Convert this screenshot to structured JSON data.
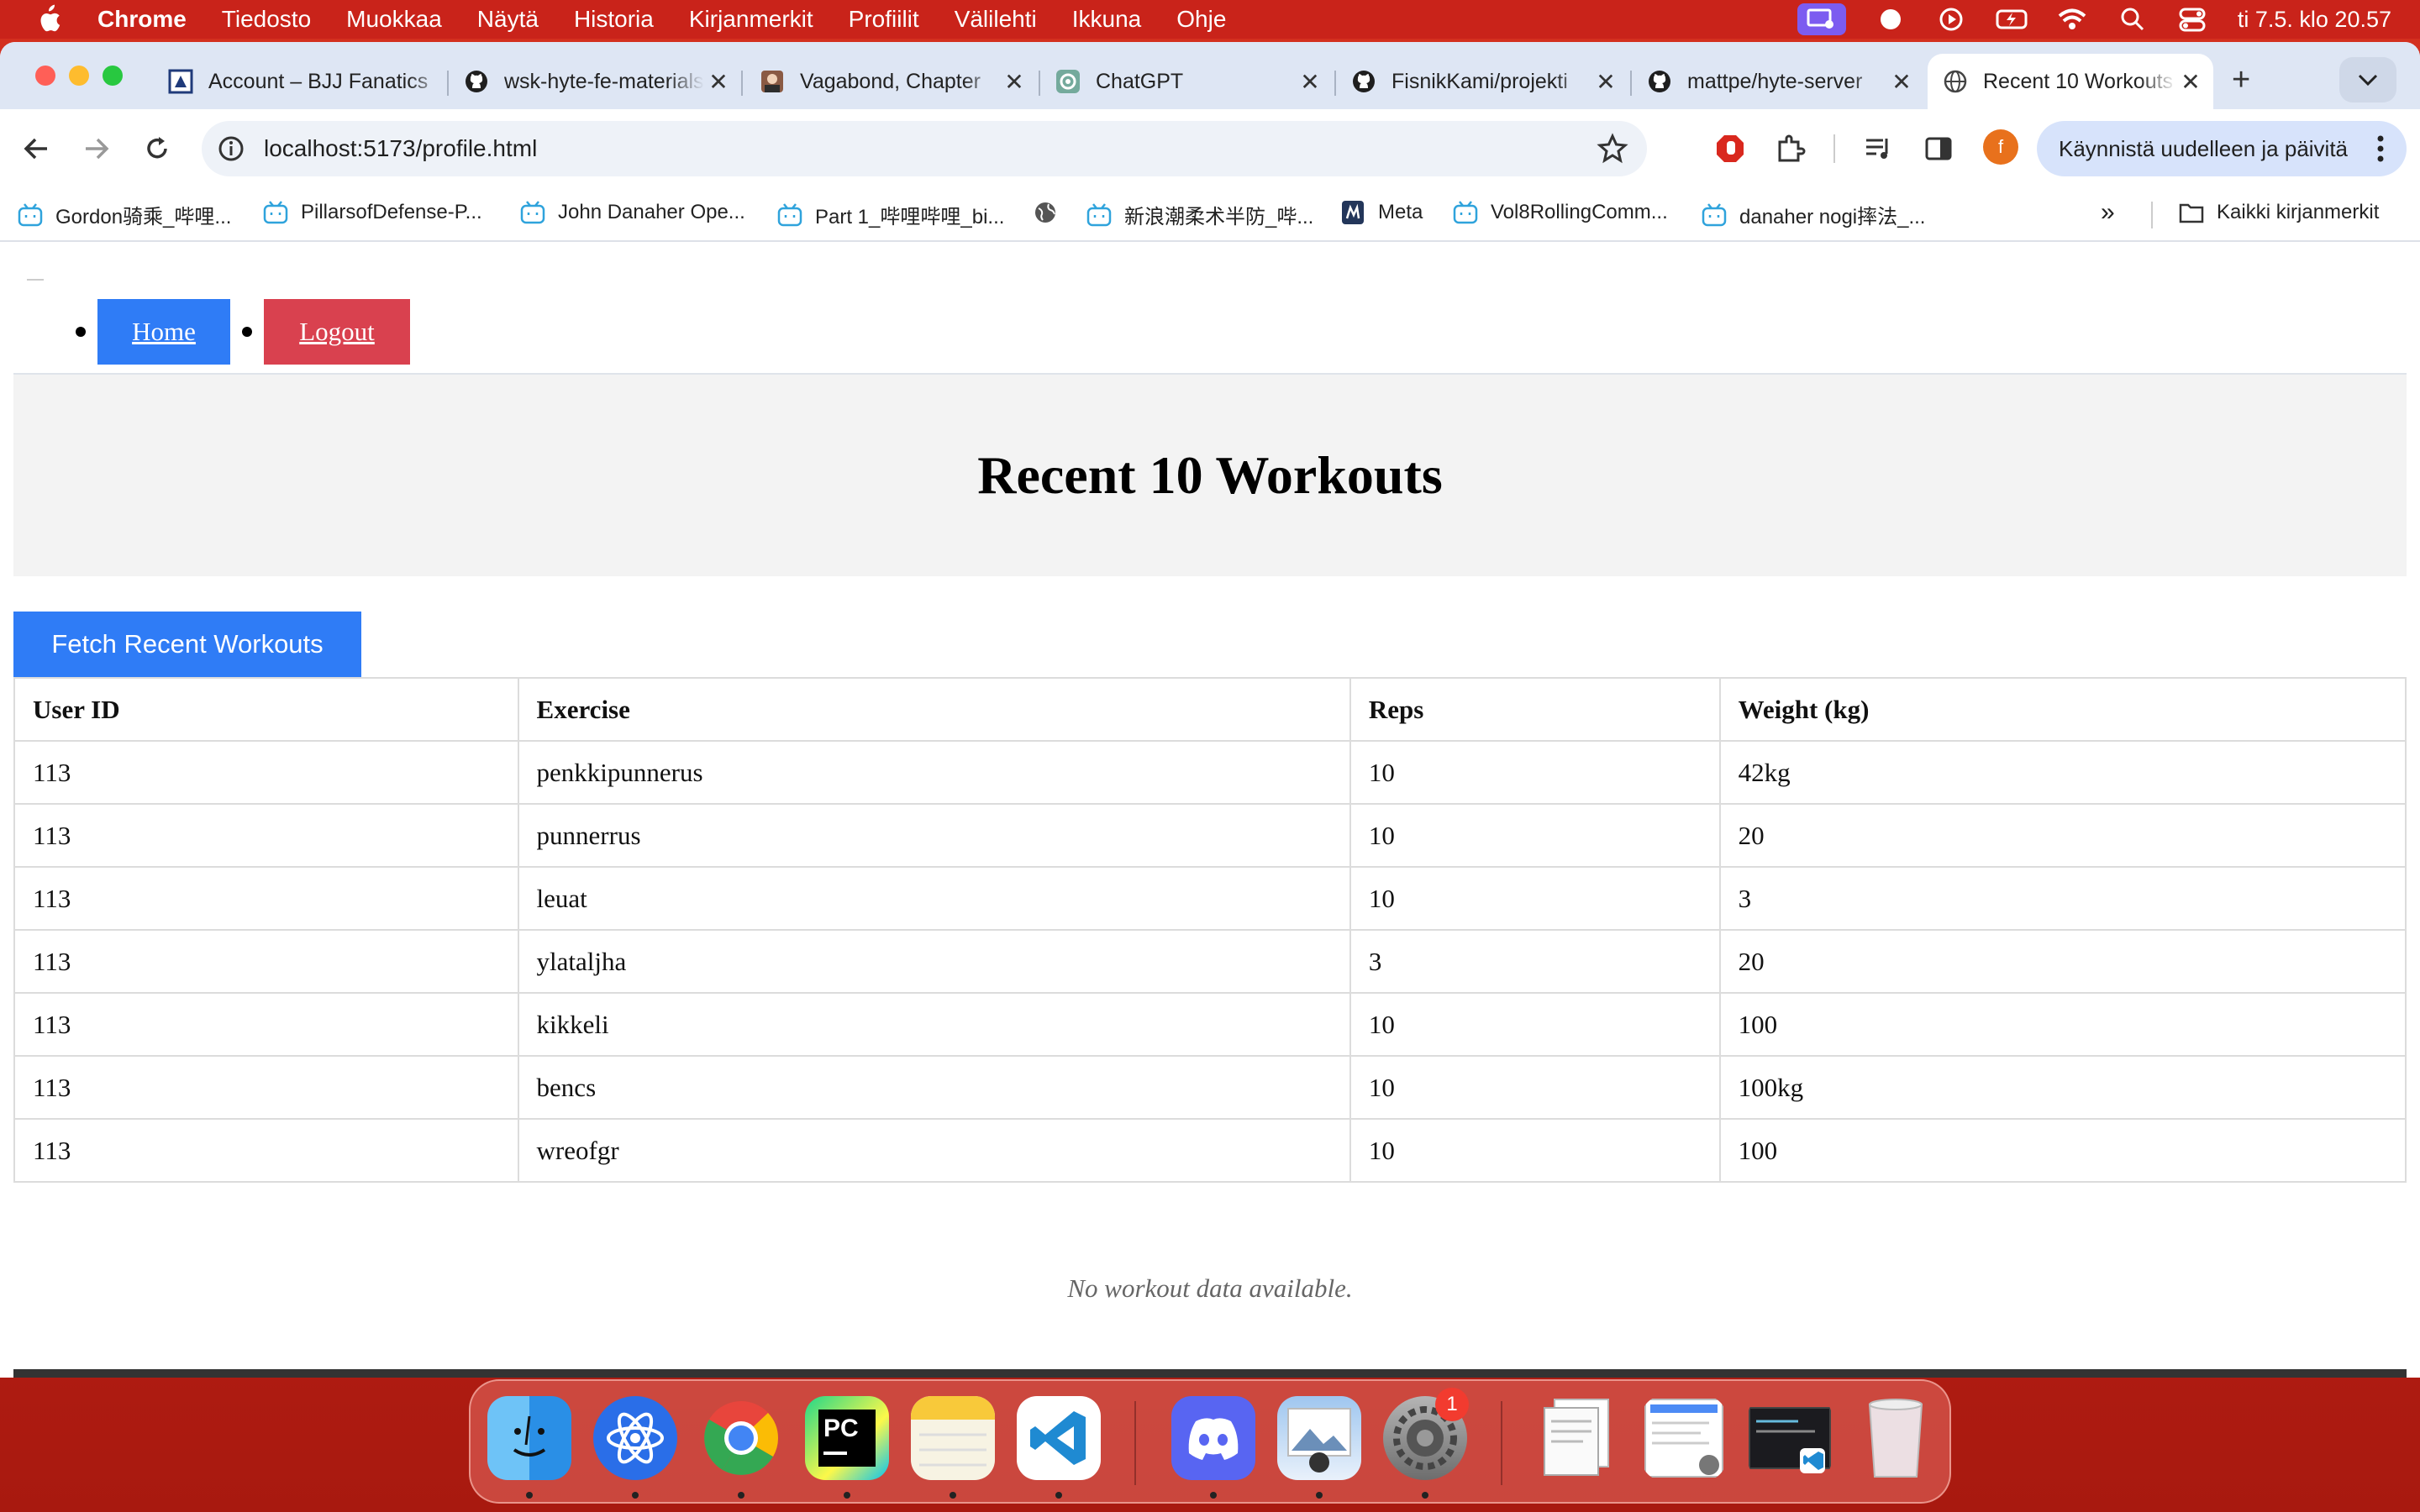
{
  "menubar": {
    "app_name": "Chrome",
    "menus": [
      "Tiedosto",
      "Muokkaa",
      "Näytä",
      "Historia",
      "Kirjanmerkit",
      "Profiilit",
      "Välilehti",
      "Ikkuna",
      "Ohje"
    ],
    "clock": "ti 7.5. klo 20.57"
  },
  "tabs": [
    {
      "title": "Account – BJJ Fanatics",
      "favicon": "bjj-icon"
    },
    {
      "title": "wsk-hyte-fe-materials",
      "favicon": "github-icon"
    },
    {
      "title": "Vagabond, Chapter",
      "favicon": "manga-icon"
    },
    {
      "title": "ChatGPT",
      "favicon": "chatgpt-icon"
    },
    {
      "title": "FisnikKami/projekti",
      "favicon": "github-icon"
    },
    {
      "title": "mattpe/hyte-server",
      "favicon": "github-icon"
    },
    {
      "title": "Recent 10 Workouts",
      "favicon": "globe-icon"
    }
  ],
  "address_bar": {
    "url": "localhost:5173/profile.html"
  },
  "relaunch_button": "Käynnistä uudelleen ja päivitä",
  "profile_initial": "f",
  "bookmarks": [
    {
      "label": "Gordon骑乘_哔哩...",
      "icon": "bilibili-icon"
    },
    {
      "label": "PillarsofDefense-P...",
      "icon": "bilibili-icon"
    },
    {
      "label": "John Danaher Ope...",
      "icon": "bilibili-icon"
    },
    {
      "label": "Part 1_哔哩哔哩_bi...",
      "icon": "bilibili-icon"
    },
    {
      "label": "",
      "icon": "globe-icon"
    },
    {
      "label": "新浪潮柔术半防_哔...",
      "icon": "bilibili-icon"
    },
    {
      "label": "Meta",
      "icon": "meta-icon"
    },
    {
      "label": "Vol8RollingComm...",
      "icon": "bilibili-icon"
    },
    {
      "label": "danaher nogi摔法_...",
      "icon": "bilibili-icon"
    }
  ],
  "all_bookmarks": "Kaikki kirjanmerkit",
  "page": {
    "nav": {
      "home": "Home",
      "logout": "Logout"
    },
    "heading": "Recent 10 Workouts",
    "fetch_button": "Fetch Recent Workouts",
    "table": {
      "headers": [
        "User ID",
        "Exercise",
        "Reps",
        "Weight (kg)"
      ],
      "rows": [
        [
          "113",
          "penkkipunnerus",
          "10",
          "42kg"
        ],
        [
          "113",
          "punnerrus",
          "10",
          "20"
        ],
        [
          "113",
          "leuat",
          "10",
          "3"
        ],
        [
          "113",
          "ylataljha",
          "3",
          "20"
        ],
        [
          "113",
          "kikkeli",
          "10",
          "100"
        ],
        [
          "113",
          "bencs",
          "10",
          "100kg"
        ],
        [
          "113",
          "wreofgr",
          "10",
          "100"
        ]
      ]
    },
    "empty_message": "No workout data available."
  },
  "dock": {
    "apps": [
      "finder",
      "safari-like",
      "chrome",
      "pycharm",
      "notes",
      "vscode",
      "discord",
      "preview",
      "system-settings",
      "document-1",
      "document-2",
      "terminal-window",
      "trash"
    ],
    "settings_badge": "1"
  },
  "colors": {
    "menubar": "#c9231a",
    "home_button": "#2f7cf6",
    "logout_button": "#d9414f",
    "footer": "#333333"
  }
}
